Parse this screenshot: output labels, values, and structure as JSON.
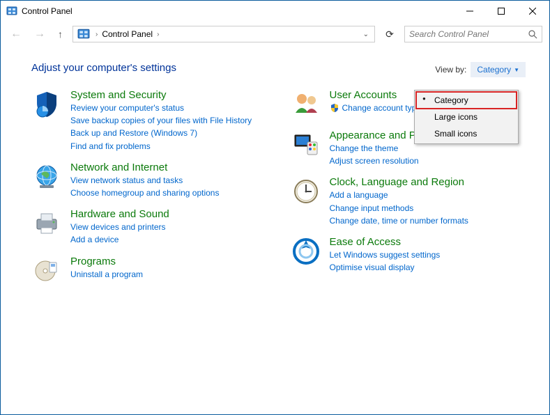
{
  "window": {
    "title": "Control Panel"
  },
  "nav": {
    "breadcrumb": "Control Panel",
    "searchPlaceholder": "Search Control Panel"
  },
  "header": {
    "title": "Adjust your computer's settings",
    "viewByLabel": "View by:",
    "viewByValue": "Category"
  },
  "viewMenu": {
    "options": [
      "Category",
      "Large icons",
      "Small icons"
    ],
    "selected": "Category"
  },
  "left": [
    {
      "name": "System and Security",
      "links": [
        "Review your computer's status",
        "Save backup copies of your files with File History",
        "Back up and Restore (Windows 7)",
        "Find and fix problems"
      ]
    },
    {
      "name": "Network and Internet",
      "links": [
        "View network status and tasks",
        "Choose homegroup and sharing options"
      ]
    },
    {
      "name": "Hardware and Sound",
      "links": [
        "View devices and printers",
        "Add a device"
      ]
    },
    {
      "name": "Programs",
      "links": [
        "Uninstall a program"
      ]
    }
  ],
  "right": [
    {
      "name": "User Accounts",
      "links": [
        "Change account type"
      ],
      "shield": [
        0
      ]
    },
    {
      "name": "Appearance and Personalisation",
      "links": [
        "Change the theme",
        "Adjust screen resolution"
      ]
    },
    {
      "name": "Clock, Language and Region",
      "links": [
        "Add a language",
        "Change input methods",
        "Change date, time or number formats"
      ]
    },
    {
      "name": "Ease of Access",
      "links": [
        "Let Windows suggest settings",
        "Optimise visual display"
      ]
    }
  ]
}
